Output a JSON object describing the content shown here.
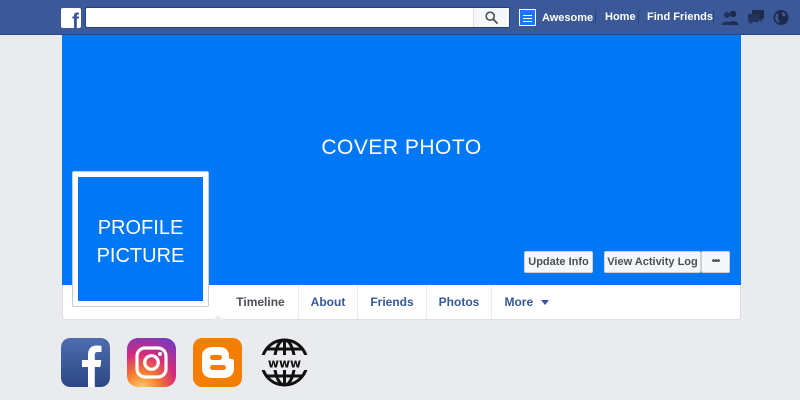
{
  "topbar": {
    "brand_letter": "f",
    "search": {
      "value": "",
      "placeholder": ""
    },
    "user_name": "Awesome",
    "nav": {
      "home": "Home",
      "find_friends": "Find Friends"
    },
    "icons": [
      "friend-requests-icon",
      "messages-icon",
      "notifications-globe-icon"
    ]
  },
  "cover": {
    "label": "COVER PHOTO",
    "buttons": {
      "update_info": "Update Info",
      "view_activity_log": "View Activity Log",
      "more": "•••"
    }
  },
  "profile": {
    "line1": "PROFILE",
    "line2": "PICTURE"
  },
  "tabs": [
    {
      "label": "Timeline"
    },
    {
      "label": "About"
    },
    {
      "label": "Friends"
    },
    {
      "label": "Photos"
    },
    {
      "label": "More"
    }
  ],
  "social_icons": [
    "facebook-icon",
    "instagram-icon",
    "blogger-icon",
    "www-globe-icon"
  ],
  "colors": {
    "facebook_blue": "#3b5998",
    "cover_blue": "#0077f5",
    "link_blue": "#365899",
    "page_background": "#e9ebee"
  }
}
